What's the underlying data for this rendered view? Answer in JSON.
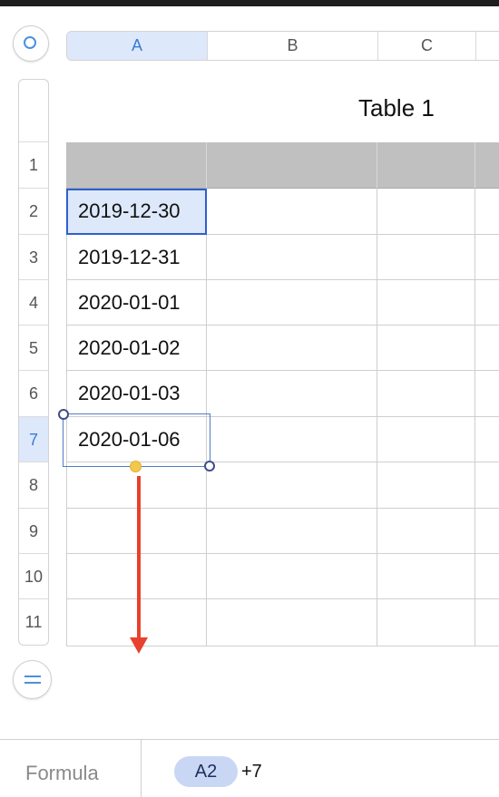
{
  "columns": [
    "A",
    "B",
    "C"
  ],
  "rows": [
    "1",
    "2",
    "3",
    "4",
    "5",
    "6",
    "7",
    "8",
    "9",
    "10",
    "11"
  ],
  "selected_column": "A",
  "selected_row": "7",
  "table": {
    "title": "Table 1",
    "cells_col_a": [
      "",
      "2019-12-30",
      "2019-12-31",
      "2020-01-01",
      "2020-01-02",
      "2020-01-03",
      "2020-01-06",
      "",
      "",
      "",
      ""
    ]
  },
  "formula_bar": {
    "label": "Formula",
    "token": "A2",
    "extra": "+7"
  },
  "colors": {
    "header_fill": "#bfc0bf",
    "selection": "#dde8fa",
    "drag_arrow": "#e8412e",
    "fill_handle": "#f2c94c"
  },
  "icons": {
    "select_all": "circle-icon",
    "add_row": "equals-icon"
  }
}
